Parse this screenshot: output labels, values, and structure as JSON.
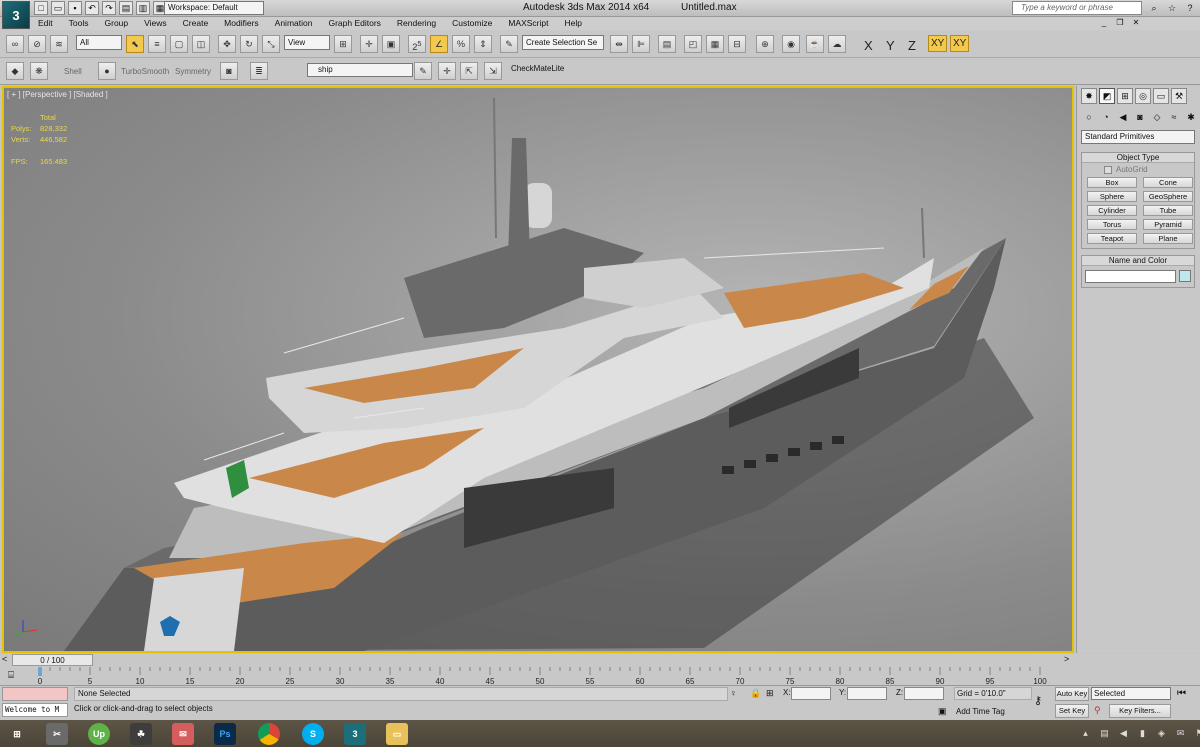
{
  "app": {
    "title": "Autodesk 3ds Max  2014 x64",
    "file": "Untitled.max",
    "logo": "3",
    "workspace": "Workspace: Default",
    "search_placeholder": "Type a keyword or phrase"
  },
  "menu": [
    "Edit",
    "Tools",
    "Group",
    "Views",
    "Create",
    "Modifiers",
    "Animation",
    "Graph Editors",
    "Rendering",
    "Customize",
    "MAXScript",
    "Help"
  ],
  "toolbar": {
    "filter": "All",
    "coord_system": "View",
    "selection_set": "Create Selection Se",
    "angle_snap": "2.5",
    "percent_snap": "%",
    "axes": [
      "X",
      "Y",
      "Z",
      "XY",
      "XY"
    ]
  },
  "toolbar2": {
    "items": [
      "Shell",
      "TurboSmooth",
      "Symmetry"
    ],
    "layer": "ship",
    "checkmate": "CheckMateLite"
  },
  "viewport": {
    "label": "[ + ] [Perspective ] [Shaded ]",
    "stats": {
      "heading": "Total",
      "polys_label": "Polys:",
      "polys": "828,332",
      "verts_label": "Verts:",
      "verts": "446,582",
      "fps_label": "FPS:",
      "fps": "165.483"
    }
  },
  "command_panel": {
    "dropdown": "Standard Primitives",
    "object_type_title": "Object Type",
    "autogrid": "AutoGrid",
    "primitives": [
      "Box",
      "Cone",
      "Sphere",
      "GeoSphere",
      "Cylinder",
      "Tube",
      "Torus",
      "Pyramid",
      "Teapot",
      "Plane"
    ],
    "name_color_title": "Name and Color"
  },
  "timeline": {
    "frame": "0 / 100",
    "ticks": [
      "0",
      "5",
      "10",
      "15",
      "20",
      "25",
      "30",
      "35",
      "40",
      "45",
      "50",
      "55",
      "60",
      "65",
      "70",
      "75",
      "80",
      "85",
      "90",
      "95",
      "100"
    ]
  },
  "status": {
    "selection": "None Selected",
    "prompt": "Click or click-and-drag to select objects",
    "maxscript": "Welcome to M",
    "x_label": "X:",
    "y_label": "Y:",
    "z_label": "Z:",
    "grid": "Grid = 0'10.0\"",
    "add_time_tag": "Add Time Tag",
    "auto_key": "Auto Key",
    "set_key": "Set Key",
    "selected": "Selected",
    "key_filters": "Key Filters..."
  },
  "taskbar": {
    "apps": [
      "windows-start",
      "snipping",
      "upwork",
      "frog",
      "chat",
      "photoshop",
      "chrome",
      "skype",
      "3dsmax",
      "explorer"
    ]
  },
  "colors": {
    "viewport_border": "#e3c200",
    "stats_text": "#e7d84a",
    "active_tool": "#f2c94c",
    "deck_wood": "#c9884a",
    "hull": "#5a5a5a"
  }
}
